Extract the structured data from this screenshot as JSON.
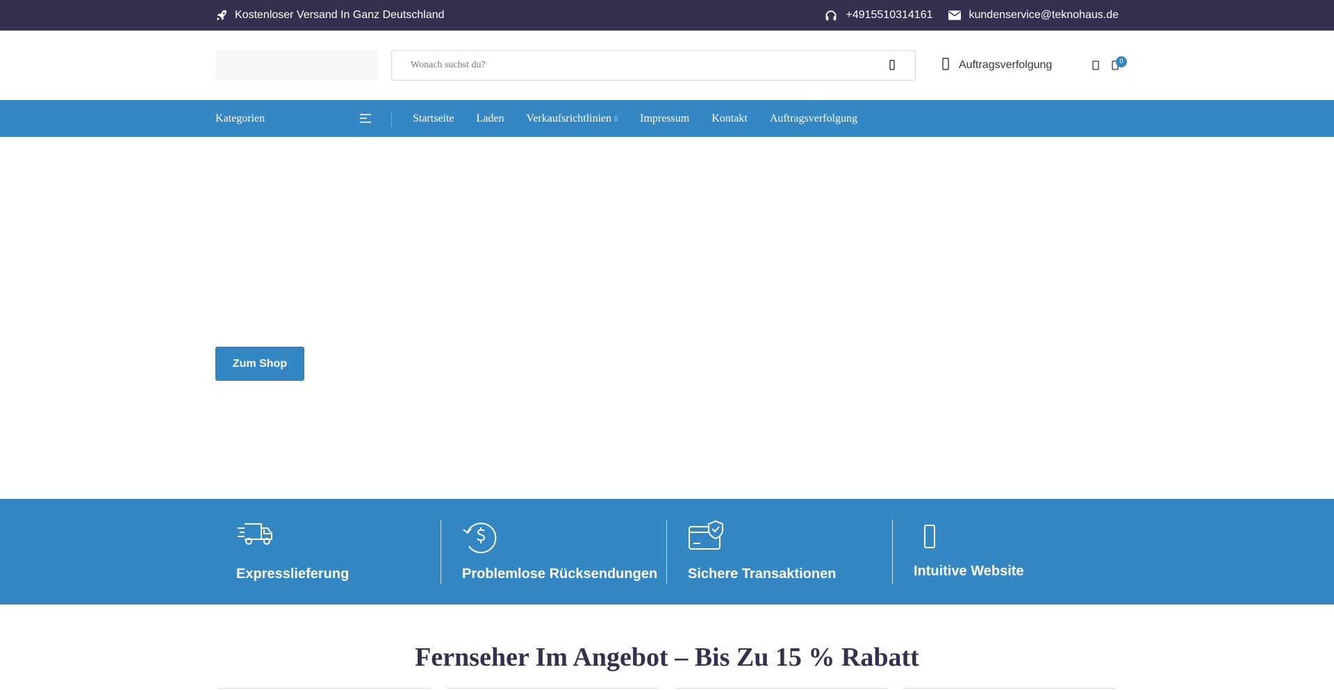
{
  "topbar": {
    "shipping_text": "Kostenloser Versand In Ganz Deutschland",
    "phone": "+4915510314161",
    "email": "kundenservice@teknohaus.de",
    "icons": [
      "rocket-icon",
      "headphones-icon",
      "envelope-icon"
    ]
  },
  "header": {
    "search_placeholder": "Wonach suchst du?",
    "tracking_label": "Auftragsverfolgung",
    "cart_count": "0"
  },
  "navbar": {
    "categories_label": "Kategorien",
    "items": [
      {
        "label": "Startseite"
      },
      {
        "label": "Laden"
      },
      {
        "label": "Verkaufsrichtlinien",
        "dropdown": true
      },
      {
        "label": "Impressum"
      },
      {
        "label": "Kontakt"
      },
      {
        "label": "Auftragsverfolgung"
      }
    ]
  },
  "hero": {
    "button_label": "Zum Shop"
  },
  "features": [
    {
      "title": "Expresslieferung",
      "icon": "truck-icon"
    },
    {
      "title": "Problemlose Rücksendungen",
      "icon": "money-return-icon"
    },
    {
      "title": "Sichere Transaktionen",
      "icon": "secure-card-icon"
    },
    {
      "title": "Intuitive Website",
      "icon": "device-icon"
    }
  ],
  "section": {
    "title": "Fernseher Im Angebot – Bis Zu 15 % Rabatt"
  },
  "colors": {
    "topbar_bg": "#35304f",
    "accent": "#3587c4",
    "heading": "#35304f"
  }
}
